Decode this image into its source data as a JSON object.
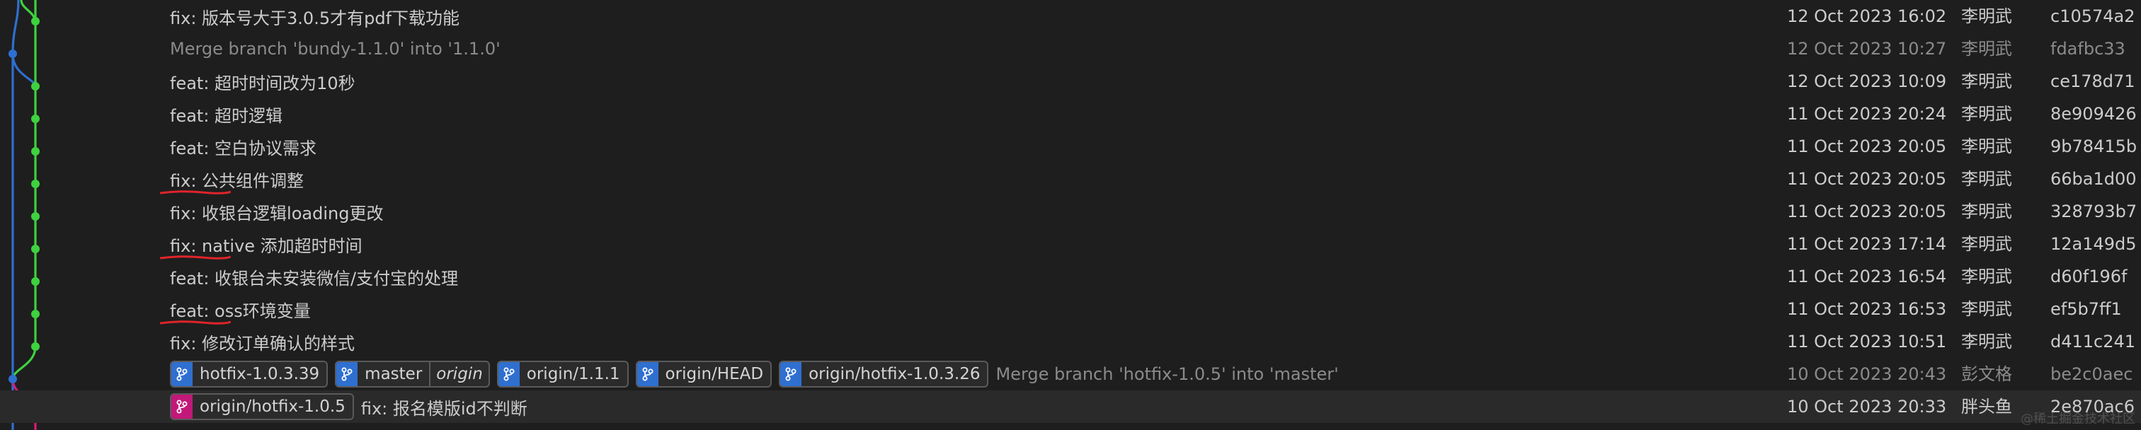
{
  "colors": {
    "lane_main": "#3fd13f",
    "lane_outer": "#2f6fd0",
    "lane_pink": "#d81b7a",
    "annotation": "#e0242a",
    "branch_badge": "#2f6fd0",
    "branch_badge_pink": "#c2187a"
  },
  "badge_icon": "git-branch-icon",
  "commits": [
    {
      "message": "fix: 版本号大于3.0.5才有pdf下载功能",
      "date": "12 Oct 2023 16:02",
      "author": "李明武",
      "hash": "c10574a2",
      "merge": false,
      "underlined": false,
      "refs": []
    },
    {
      "message": "Merge branch 'bundy-1.1.0' into '1.1.0'",
      "date": "12 Oct 2023 10:27",
      "author": "李明武",
      "hash": "fdafbc33",
      "merge": true,
      "underlined": false,
      "refs": []
    },
    {
      "message": "feat: 超时时间改为10秒",
      "date": "12 Oct 2023 10:09",
      "author": "李明武",
      "hash": "ce178d71",
      "merge": false,
      "underlined": false,
      "refs": []
    },
    {
      "message": "feat: 超时逻辑",
      "date": "11 Oct 2023 20:24",
      "author": "李明武",
      "hash": "8e909426",
      "merge": false,
      "underlined": false,
      "refs": []
    },
    {
      "message": "feat: 空白协议需求",
      "date": "11 Oct 2023 20:05",
      "author": "李明武",
      "hash": "9b78415b",
      "merge": false,
      "underlined": false,
      "refs": []
    },
    {
      "message": "fix: 公共组件调整",
      "date": "11 Oct 2023 20:05",
      "author": "李明武",
      "hash": "66ba1d00",
      "merge": false,
      "underlined": true,
      "refs": []
    },
    {
      "message": "fix: 收银台逻辑loading更改",
      "date": "11 Oct 2023 20:05",
      "author": "李明武",
      "hash": "328793b7",
      "merge": false,
      "underlined": false,
      "refs": []
    },
    {
      "message": "fix: native 添加超时时间",
      "date": "11 Oct 2023 17:14",
      "author": "李明武",
      "hash": "12a149d5",
      "merge": false,
      "underlined": true,
      "refs": []
    },
    {
      "message": "feat: 收银台未安装微信/支付宝的处理",
      "date": "11 Oct 2023 16:54",
      "author": "李明武",
      "hash": "d60f196f",
      "merge": false,
      "underlined": false,
      "refs": []
    },
    {
      "message": "feat: oss环境变量",
      "date": "11 Oct 2023 16:53",
      "author": "李明武",
      "hash": "ef5b7ff1",
      "merge": false,
      "underlined": true,
      "refs": []
    },
    {
      "message": "fix: 修改订单确认的样式",
      "date": "11 Oct 2023 10:51",
      "author": "李明武",
      "hash": "d411c241",
      "merge": false,
      "underlined": false,
      "refs": []
    },
    {
      "message": "Merge branch 'hotfix-1.0.5' into 'master'",
      "date": "10 Oct 2023 20:43",
      "author": "彭文格",
      "hash": "be2c0aec",
      "merge": true,
      "underlined": false,
      "refs": [
        {
          "label": "hotfix-1.0.3.39",
          "origin": "",
          "color": "blue"
        },
        {
          "label": "master",
          "origin": "origin",
          "color": "blue"
        },
        {
          "label": "origin/1.1.1",
          "origin": "",
          "color": "blue"
        },
        {
          "label": "origin/HEAD",
          "origin": "",
          "color": "blue"
        },
        {
          "label": "origin/hotfix-1.0.3.26",
          "origin": "",
          "color": "blue"
        }
      ]
    },
    {
      "message": "fix: 报名模版id不判断",
      "date": "10 Oct 2023 20:33",
      "author": "胖头鱼",
      "hash": "2e870ac6",
      "merge": false,
      "underlined": false,
      "selected": true,
      "refs": [
        {
          "label": "origin/hotfix-1.0.5",
          "origin": "",
          "color": "pink"
        }
      ]
    }
  ],
  "watermark": "@稀土掘金技术社区"
}
